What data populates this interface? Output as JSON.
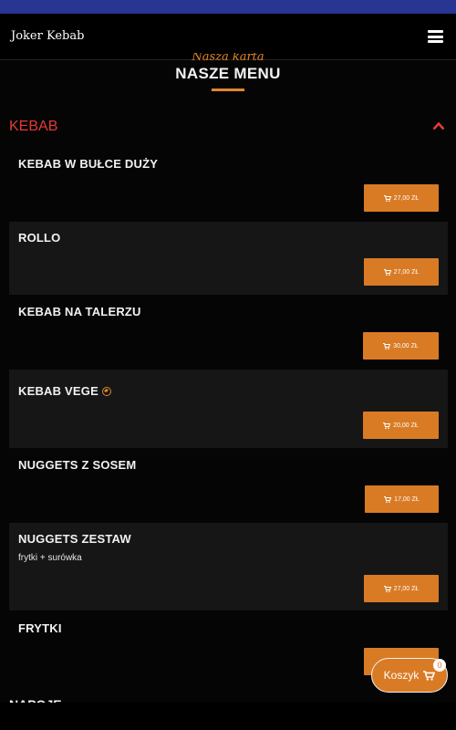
{
  "header": {
    "brand": "Joker Kebab",
    "menu_icon": "hamburger-icon"
  },
  "section": {
    "script_text": "Nasza karta",
    "title": "NASZE MENU"
  },
  "category": {
    "name": "KEBAB",
    "toggle_icon": "chevron-up-icon"
  },
  "items": [
    {
      "name": "KEBAB W BUŁCE DUŻY",
      "price": "27,00 ZŁ"
    },
    {
      "name": "ROLLO",
      "price": "27,00 ZŁ"
    },
    {
      "name": "KEBAB NA TALERZU",
      "price": "30,00 ZŁ"
    },
    {
      "name": "KEBAB VEGE",
      "price": "20,00 ZŁ",
      "badge_icon": "vegetarian-leaf-icon"
    },
    {
      "name": "NUGGETS Z SOSEM",
      "price": "17,00 ZŁ"
    },
    {
      "name": "NUGGETS ZESTAW",
      "description": "frytki + surówka",
      "price": "27,00 ZŁ"
    },
    {
      "name": "FRYTKI",
      "price": ""
    }
  ],
  "next_category": "NAPOJE",
  "cart": {
    "label": "Koszyk",
    "count": "0",
    "icon": "cart-icon"
  },
  "colors": {
    "accent": "#d97b25",
    "category": "#e53935",
    "background": "#050505",
    "top_strip": "#283593"
  }
}
